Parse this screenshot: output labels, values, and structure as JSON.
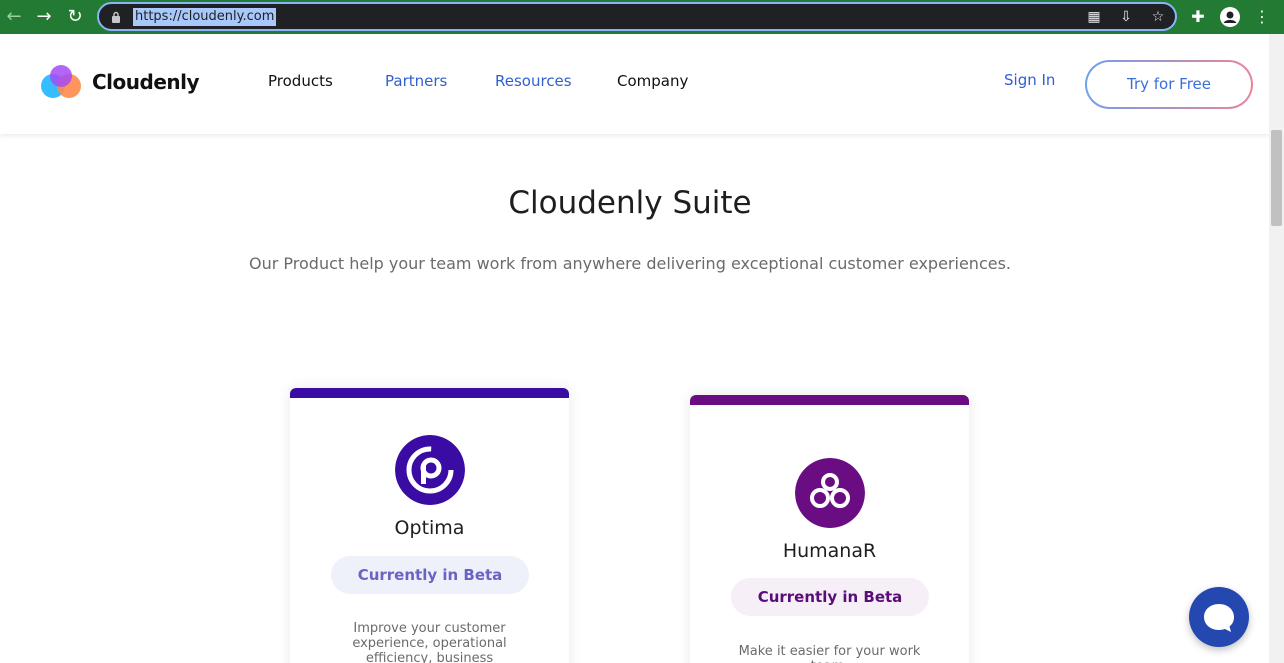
{
  "browser": {
    "url": "https://cloudenly.com",
    "back_icon": "back-arrow-icon",
    "forward_icon": "forward-arrow-icon",
    "reload_icon": "reload-icon",
    "accent_color": "#237a32"
  },
  "header": {
    "brand": "Cloudenly",
    "nav": [
      {
        "label": "Products",
        "color": "#111111"
      },
      {
        "label": "Partners",
        "color": "#2f5fd0"
      },
      {
        "label": "Resources",
        "color": "#2f5fd0"
      },
      {
        "label": "Company",
        "color": "#111111"
      }
    ],
    "sign_in": "Sign In",
    "try_free": "Try for Free"
  },
  "hero": {
    "title": "Cloudenly Suite",
    "subtitle": "Our Product help your team work from anywhere delivering exceptional customer experiences."
  },
  "products": [
    {
      "name": "Optima",
      "badge": "Currently in Beta",
      "description": "Improve your customer experience, operational efficiency, business",
      "accent": "#3a0ca3",
      "badge_bg": "#eef0fa",
      "badge_color": "#6a63c6"
    },
    {
      "name": "HumanaR",
      "badge": "Currently in Beta",
      "description": "Make it easier for your work team.",
      "accent": "#6a0d83",
      "badge_bg": "#f6eff8",
      "badge_color": "#5a0c78"
    }
  ],
  "chat": {
    "icon": "chat-bubble-icon",
    "color": "#2548b0"
  }
}
